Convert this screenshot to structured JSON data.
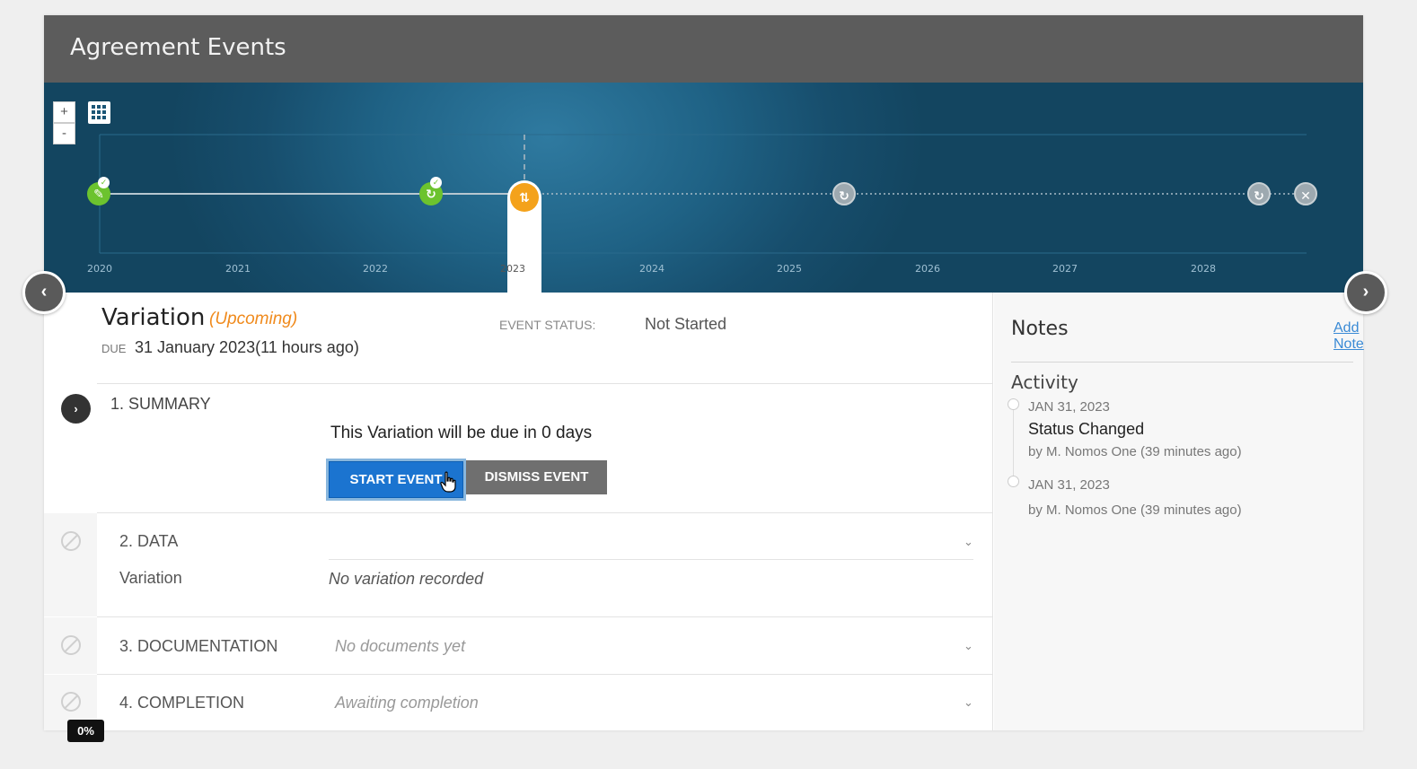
{
  "header": {
    "title": "Agreement Events"
  },
  "timeline": {
    "zoom_in": "+",
    "zoom_out": "-",
    "years": [
      "2020",
      "2021",
      "2022",
      "2023",
      "2024",
      "2025",
      "2026",
      "2027",
      "2028"
    ],
    "events": [
      {
        "name": "completed-event",
        "status": "completed",
        "icon": "check-icon"
      },
      {
        "name": "completed-event",
        "status": "completed",
        "icon": "check-icon"
      },
      {
        "name": "current-event",
        "status": "upcoming",
        "icon": "variation-icon"
      },
      {
        "name": "future-event",
        "status": "pending",
        "icon": "refresh-icon"
      },
      {
        "name": "future-event",
        "status": "pending",
        "icon": "refresh-icon"
      },
      {
        "name": "end-event",
        "status": "end",
        "icon": "close-icon"
      }
    ]
  },
  "event": {
    "title": "Variation",
    "state": "(Upcoming)",
    "due_label": "DUE",
    "due_value": "31 January 2023(11 hours ago)",
    "status_label": "EVENT STATUS:",
    "status_value": "Not Started"
  },
  "sections": {
    "summary": {
      "heading": "1. SUMMARY",
      "text": "This Variation will be due in 0 days",
      "start_label": "START EVENT",
      "dismiss_label": "DISMISS EVENT"
    },
    "data": {
      "heading": "2. DATA",
      "field_label": "Variation",
      "field_value": "No variation recorded"
    },
    "documentation": {
      "heading": "3. DOCUMENTATION",
      "placeholder": "No documents yet"
    },
    "completion": {
      "heading": "4. COMPLETION",
      "placeholder": "Awaiting completion"
    }
  },
  "progress": {
    "label": "0%",
    "value": 0
  },
  "notes": {
    "title": "Notes",
    "add_label": "Add Note",
    "activity_title": "Activity",
    "items": [
      {
        "date": "JAN 31, 2023",
        "action": "Status Changed",
        "by": "by M. Nomos One (39 minutes ago)"
      },
      {
        "date": "JAN 31, 2023",
        "action": "",
        "by": "by M. Nomos One (39 minutes ago)"
      }
    ]
  },
  "colors": {
    "accent_blue": "#1b74d0",
    "upcoming_orange": "#f08a1c",
    "completed_green": "#6cc32e",
    "timeline_bg": "#1b5676",
    "header_bg": "#5c5c5c"
  }
}
